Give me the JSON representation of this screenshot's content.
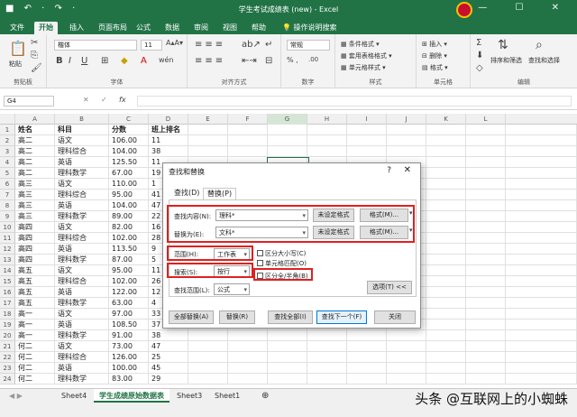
{
  "window": {
    "title": "学生考试成绩表 (new)  -  Excel",
    "quick_access": "■ ↶ · ↷ ·",
    "controls": "— ☐ ✕"
  },
  "tabs": [
    "文件",
    "开始",
    "插入",
    "页面布局",
    "公式",
    "数据",
    "审阅",
    "视图",
    "帮助"
  ],
  "active_tab": "开始",
  "tell_me": "操作说明搜索",
  "ribbon": {
    "clipboard": {
      "paste": "粘贴",
      "label": "剪贴板"
    },
    "font": {
      "name": "楷体",
      "size": "11",
      "label": "字体"
    },
    "alignment": {
      "label": "对齐方式"
    },
    "number": {
      "format": "常规",
      "label": "数字"
    },
    "styles": {
      "conditional": "条件格式",
      "table": "套用表格格式",
      "cell": "单元格样式",
      "label": "样式"
    },
    "cells": {
      "insert": "插入",
      "delete": "删除",
      "format": "格式",
      "label": "单元格"
    },
    "editing": {
      "sort": "排序和筛选",
      "find": "查找和选择",
      "label": "编辑"
    }
  },
  "formula_bar": {
    "name_box": "G4",
    "fx": "fx",
    "cancel": "✕",
    "confirm": "✓"
  },
  "columns": [
    "A",
    "B",
    "C",
    "D",
    "E",
    "F",
    "G",
    "H",
    "I",
    "J",
    "K",
    "L"
  ],
  "rows": [
    [
      "姓名",
      "科目",
      "分数",
      "班上排名"
    ],
    [
      "高二",
      "语文",
      "106.00",
      "11"
    ],
    [
      "高二",
      "理科综合",
      "104.00",
      "38"
    ],
    [
      "高二",
      "英语",
      "125.50",
      "11"
    ],
    [
      "高二",
      "理科数学",
      "67.00",
      "19"
    ],
    [
      "高三",
      "语文",
      "110.00",
      "1"
    ],
    [
      "高三",
      "理科综合",
      "95.00",
      "41"
    ],
    [
      "高三",
      "英语",
      "104.00",
      "47"
    ],
    [
      "高三",
      "理科数学",
      "89.00",
      "22"
    ],
    [
      "高四",
      "语文",
      "82.00",
      "16"
    ],
    [
      "高四",
      "理科综合",
      "102.00",
      "28"
    ],
    [
      "高四",
      "英语",
      "113.50",
      "9"
    ],
    [
      "高四",
      "理科数学",
      "87.00",
      "5"
    ],
    [
      "高五",
      "语文",
      "95.00",
      "11"
    ],
    [
      "高五",
      "理科综合",
      "102.00",
      "26"
    ],
    [
      "高五",
      "英语",
      "122.00",
      "12"
    ],
    [
      "高五",
      "理科数学",
      "63.00",
      "4"
    ],
    [
      "高一",
      "语文",
      "97.00",
      "33"
    ],
    [
      "高一",
      "英语",
      "108.50",
      "37"
    ],
    [
      "高一",
      "理科数学",
      "91.00",
      "38"
    ],
    [
      "何二",
      "语文",
      "73.00",
      "47"
    ],
    [
      "何二",
      "理科综合",
      "126.00",
      "25"
    ],
    [
      "何二",
      "英语",
      "100.00",
      "45"
    ],
    [
      "何二",
      "理科数学",
      "83.00",
      "29"
    ]
  ],
  "sheets": [
    "Sheet4",
    "学生成绩原始数据表",
    "Sheet3",
    "Sheet1"
  ],
  "active_sheet": "学生成绩原始数据表",
  "sheet_nav": "◀ ▶",
  "add_sheet": "⊕",
  "watermark": "头条 @互联网上的小蜘蛛",
  "dialog": {
    "title": "查找和替换",
    "help": "?",
    "close": "✕",
    "tabs": [
      "查找(D)",
      "替换(P)"
    ],
    "active_tab": "替换(P)",
    "find_label": "查找内容(N):",
    "find_value": "理科*",
    "replace_label": "替换为(E):",
    "replace_value": "文科*",
    "no_format": "未设定格式",
    "format_btn": "格式(M)...",
    "within_label": "范围(H):",
    "within_value": "工作表",
    "search_label": "搜索(S):",
    "search_value": "按行",
    "lookin_label": "查找范围(L):",
    "lookin_value": "公式",
    "match_case": "区分大小写(C)",
    "match_entire": "单元格匹配(O)",
    "match_width": "区分全/半角(B)",
    "options_btn": "选项(T) <<",
    "replace_all": "全部替换(A)",
    "replace": "替换(R)",
    "find_all": "查找全部(I)",
    "find_next": "查找下一个(F)",
    "close_btn": "关闭"
  },
  "colors": {
    "accent": "#217346",
    "highlight": "#e02020"
  }
}
